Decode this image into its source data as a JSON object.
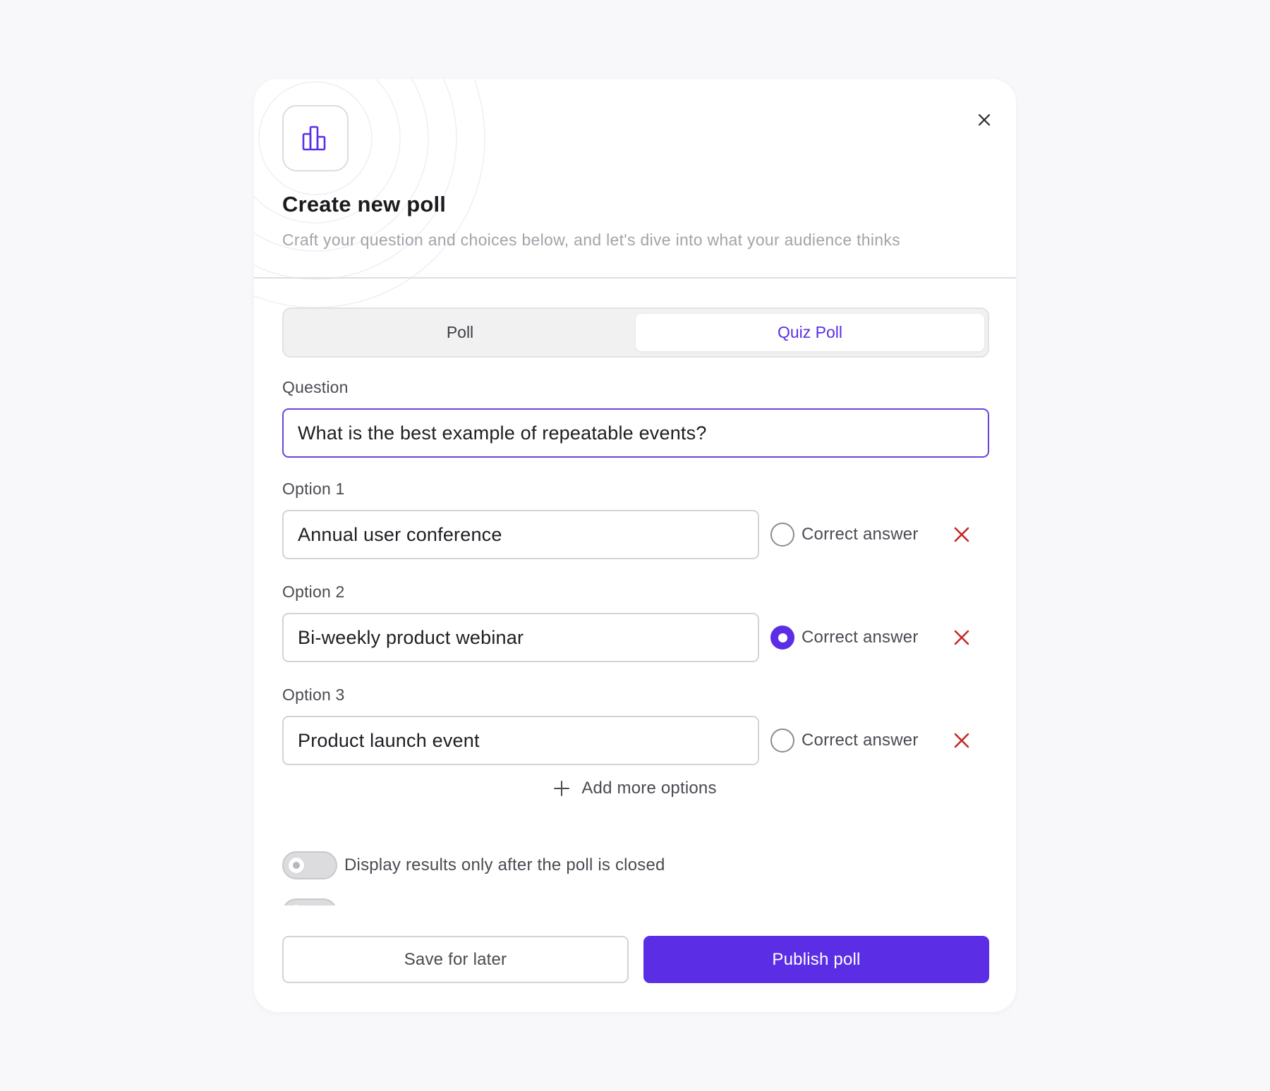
{
  "modal": {
    "title": "Create new poll",
    "subtitle": "Craft your question and choices below, and let's dive into what your audience thinks",
    "header_icon": "bar-chart-icon",
    "close_icon": "close-icon"
  },
  "tabs": [
    {
      "label": "Poll",
      "active": false
    },
    {
      "label": "Quiz Poll",
      "active": true
    }
  ],
  "question": {
    "label": "Question",
    "value": "What is the best example of repeatable events?"
  },
  "options": [
    {
      "label": "Option 1",
      "value": "Annual user conference",
      "correct_label": "Correct answer",
      "correct": false
    },
    {
      "label": "Option 2",
      "value": "Bi-weekly product webinar",
      "correct_label": "Correct answer",
      "correct": true
    },
    {
      "label": "Option 3",
      "value": "Product launch event",
      "correct_label": "Correct answer",
      "correct": false
    }
  ],
  "add_more": {
    "label": "Add more options",
    "icon": "plus-icon"
  },
  "toggles": [
    {
      "label": "Display results only after the poll is closed",
      "on": false
    }
  ],
  "footer": {
    "save_label": "Save for later",
    "publish_label": "Publish poll"
  },
  "colors": {
    "accent": "#5b2ee6",
    "delete": "#c62828",
    "background": "#f8f8fa"
  }
}
